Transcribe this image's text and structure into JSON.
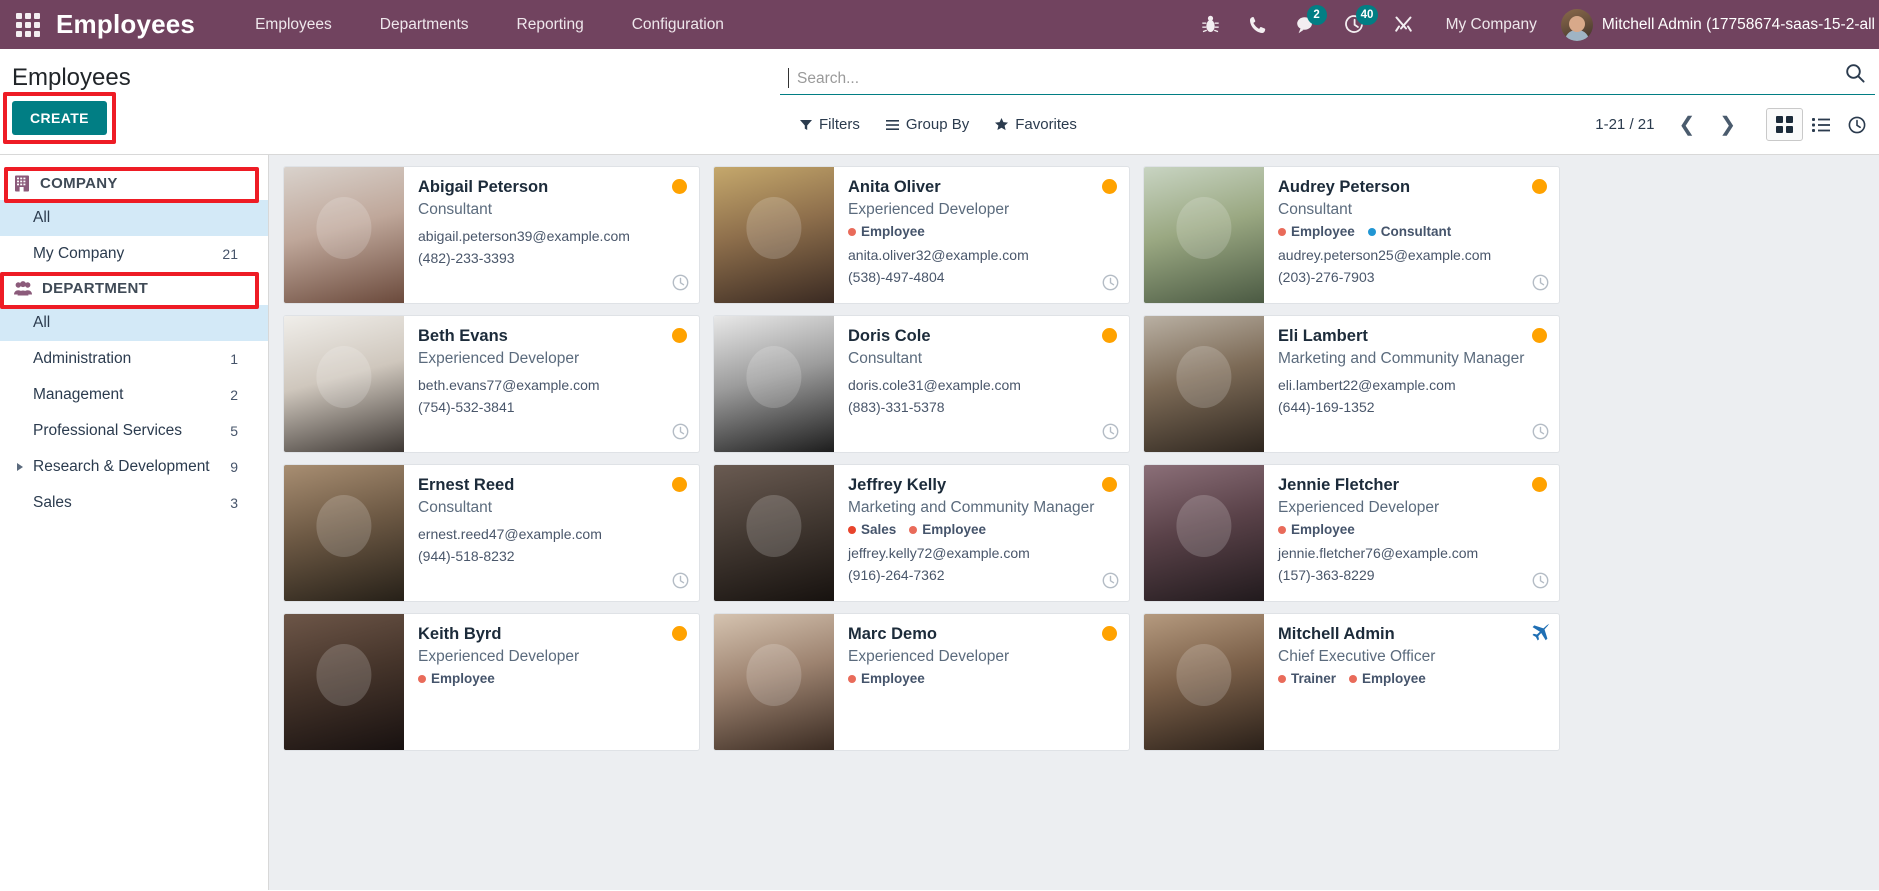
{
  "navbar": {
    "apps_icon": "apps-grid-icon",
    "brand": "Employees",
    "menu": [
      {
        "label": "Employees"
      },
      {
        "label": "Departments"
      },
      {
        "label": "Reporting"
      },
      {
        "label": "Configuration"
      }
    ],
    "icons": [
      {
        "name": "bug-icon",
        "badge": null
      },
      {
        "name": "phone-icon",
        "badge": null
      },
      {
        "name": "chat-icon",
        "badge": "2"
      },
      {
        "name": "activity-clock-icon",
        "badge": "40"
      },
      {
        "name": "tools-icon",
        "badge": null
      }
    ],
    "company": "My Company",
    "user": "Mitchell Admin (17758674-saas-15-2-all",
    "bg_color": "#71435f",
    "badge_color": "#017e84"
  },
  "control_panel": {
    "title": "Employees",
    "create_label": "CREATE",
    "create_color": "#017e84",
    "annotation_color": "#ee1c25",
    "search": {
      "placeholder": "Search...",
      "value": ""
    },
    "tools": [
      {
        "label": "Filters",
        "icon": "filter-icon"
      },
      {
        "label": "Group By",
        "icon": "group-by-icon"
      },
      {
        "label": "Favorites",
        "icon": "star-icon"
      }
    ],
    "pager": "1-21 / 21",
    "views": [
      {
        "name": "kanban-view",
        "active": true
      },
      {
        "name": "list-view",
        "active": false
      },
      {
        "name": "activity-view",
        "active": false
      }
    ]
  },
  "sidebar": {
    "sections": [
      {
        "title": "COMPANY",
        "icon": "building-icon",
        "annotated": true,
        "items": [
          {
            "label": "All",
            "count": "",
            "active": true,
            "expandable": false
          },
          {
            "label": "My Company",
            "count": "21",
            "active": false,
            "expandable": false
          }
        ]
      },
      {
        "title": "DEPARTMENT",
        "icon": "people-icon",
        "annotated": true,
        "items": [
          {
            "label": "All",
            "count": "",
            "active": true,
            "expandable": false
          },
          {
            "label": "Administration",
            "count": "1",
            "active": false,
            "expandable": false
          },
          {
            "label": "Management",
            "count": "2",
            "active": false,
            "expandable": false
          },
          {
            "label": "Professional Services",
            "count": "5",
            "active": false,
            "expandable": false
          },
          {
            "label": "Research & Development",
            "count": "9",
            "active": false,
            "expandable": true
          },
          {
            "label": "Sales",
            "count": "3",
            "active": false,
            "expandable": false
          }
        ]
      }
    ]
  },
  "colors": {
    "status_orange": "#ffa200",
    "tag_employee": "#e96b5a",
    "tag_consultant": "#2196d3",
    "tag_sales": "#e8442c",
    "tag_trainer": "#e96b5a",
    "plane_blue": "#1f6fb4"
  },
  "employees": [
    {
      "name": "Abigail Peterson",
      "job": "Consultant",
      "tags": [],
      "email": "abigail.peterson39@example.com",
      "phone": "(482)-233-3393",
      "status": "orange",
      "badge_icon": "status-dot",
      "clock": true
    },
    {
      "name": "Anita Oliver",
      "job": "Experienced Developer",
      "tags": [
        {
          "label": "Employee",
          "color": "#e96b5a"
        }
      ],
      "email": "anita.oliver32@example.com",
      "phone": "(538)-497-4804",
      "status": "orange",
      "badge_icon": "status-dot",
      "clock": true
    },
    {
      "name": "Audrey Peterson",
      "job": "Consultant",
      "tags": [
        {
          "label": "Employee",
          "color": "#e96b5a"
        },
        {
          "label": "Consultant",
          "color": "#2196d3"
        }
      ],
      "email": "audrey.peterson25@example.com",
      "phone": "(203)-276-7903",
      "status": "orange",
      "badge_icon": "status-dot",
      "clock": true
    },
    {
      "name": "Beth Evans",
      "job": "Experienced Developer",
      "tags": [],
      "email": "beth.evans77@example.com",
      "phone": "(754)-532-3841",
      "status": "orange",
      "badge_icon": "status-dot",
      "clock": true
    },
    {
      "name": "Doris Cole",
      "job": "Consultant",
      "tags": [],
      "email": "doris.cole31@example.com",
      "phone": "(883)-331-5378",
      "status": "orange",
      "badge_icon": "status-dot",
      "clock": true
    },
    {
      "name": "Eli Lambert",
      "job": "Marketing and Community Manager",
      "tags": [],
      "email": "eli.lambert22@example.com",
      "phone": "(644)-169-1352",
      "status": "orange",
      "badge_icon": "status-dot",
      "clock": true
    },
    {
      "name": "Ernest Reed",
      "job": "Consultant",
      "tags": [],
      "email": "ernest.reed47@example.com",
      "phone": "(944)-518-8232",
      "status": "orange",
      "badge_icon": "status-dot",
      "clock": true
    },
    {
      "name": "Jeffrey Kelly",
      "job": "Marketing and Community Manager",
      "tags": [
        {
          "label": "Sales",
          "color": "#e8442c"
        },
        {
          "label": "Employee",
          "color": "#e96b5a"
        }
      ],
      "email": "jeffrey.kelly72@example.com",
      "phone": "(916)-264-7362",
      "status": "orange",
      "badge_icon": "status-dot",
      "clock": true
    },
    {
      "name": "Jennie Fletcher",
      "job": "Experienced Developer",
      "tags": [
        {
          "label": "Employee",
          "color": "#e96b5a"
        }
      ],
      "email": "jennie.fletcher76@example.com",
      "phone": "(157)-363-8229",
      "status": "orange",
      "badge_icon": "status-dot",
      "clock": true
    },
    {
      "name": "Keith Byrd",
      "job": "Experienced Developer",
      "tags": [
        {
          "label": "Employee",
          "color": "#e96b5a"
        }
      ],
      "email": "",
      "phone": "",
      "status": "orange",
      "badge_icon": "status-dot",
      "clock": false
    },
    {
      "name": "Marc Demo",
      "job": "Experienced Developer",
      "tags": [
        {
          "label": "Employee",
          "color": "#e96b5a"
        }
      ],
      "email": "",
      "phone": "",
      "status": "orange",
      "badge_icon": "status-dot",
      "clock": false
    },
    {
      "name": "Mitchell Admin",
      "job": "Chief Executive Officer",
      "tags": [
        {
          "label": "Trainer",
          "color": "#e96b5a"
        },
        {
          "label": "Employee",
          "color": "#e96b5a"
        }
      ],
      "email": "",
      "phone": "",
      "status": "plane",
      "badge_icon": "plane-icon",
      "clock": false
    }
  ]
}
